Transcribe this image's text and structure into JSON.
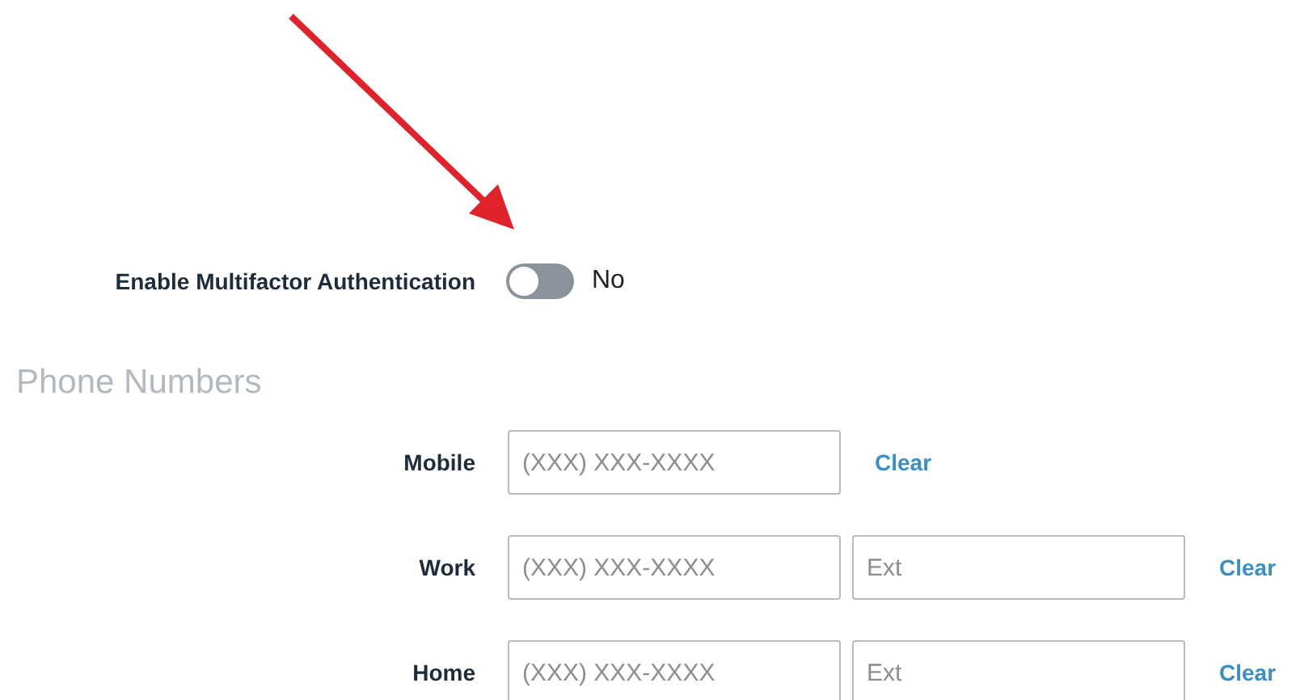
{
  "mfa": {
    "label": "Enable Multifactor Authentication",
    "on": false,
    "state_text": "No"
  },
  "phone_section": {
    "title": "Phone Numbers",
    "rows": [
      {
        "label": "Mobile",
        "placeholder": "(XXX) XXX-XXXX",
        "clear": "Clear"
      },
      {
        "label": "Work",
        "placeholder": "(XXX) XXX-XXXX",
        "ext_placeholder": "Ext",
        "clear": "Clear"
      },
      {
        "label": "Home",
        "placeholder": "(XXX) XXX-XXXX",
        "ext_placeholder": "Ext",
        "clear": "Clear"
      }
    ]
  }
}
